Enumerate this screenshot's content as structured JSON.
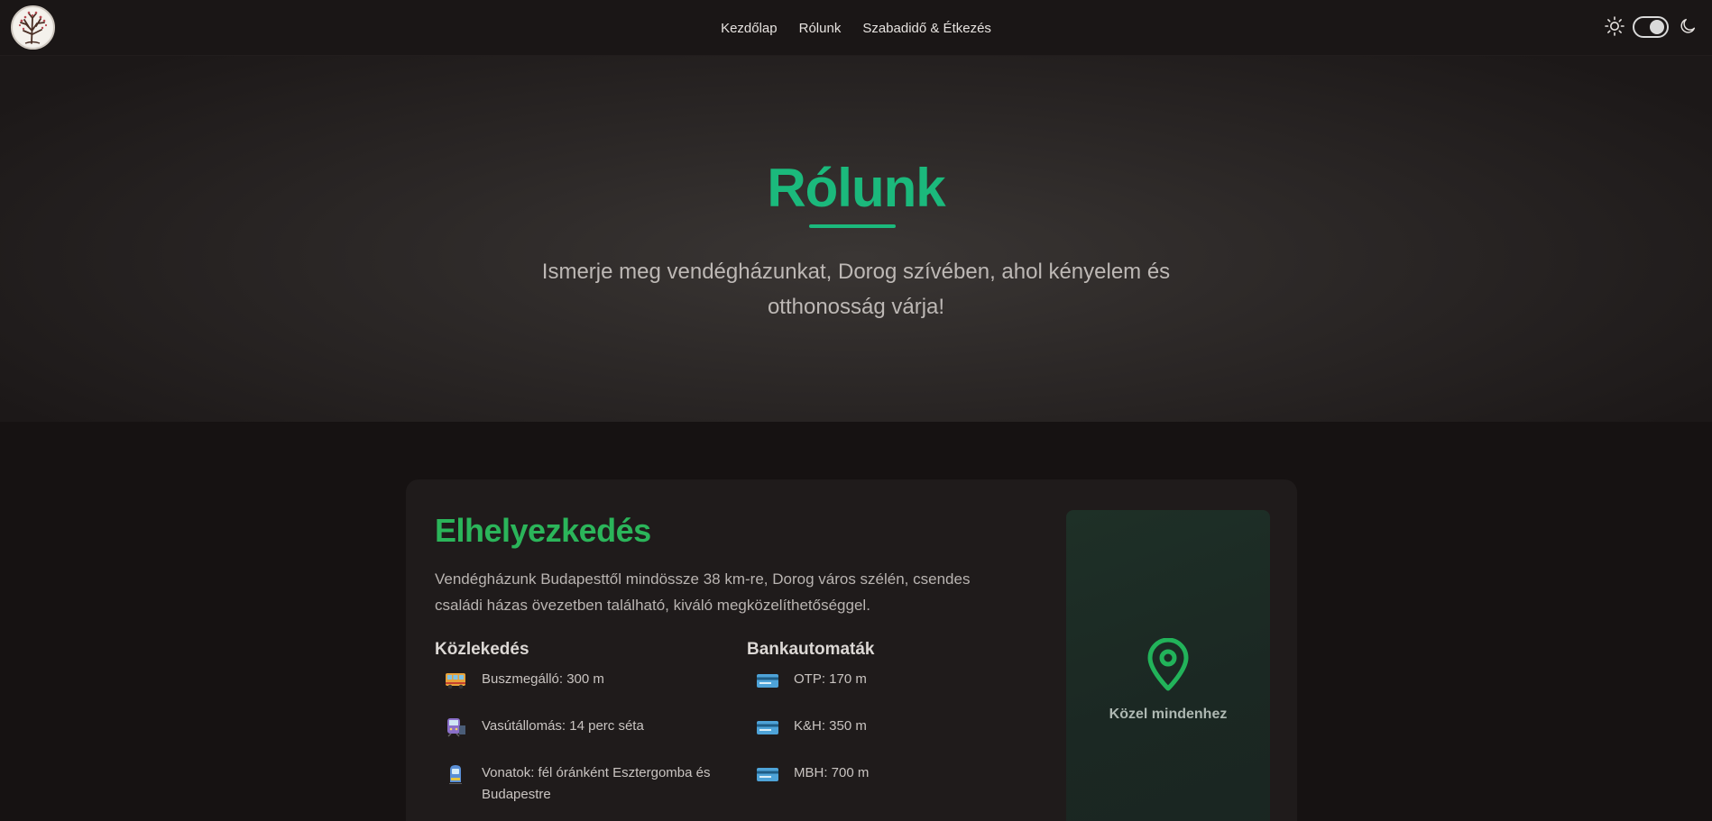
{
  "nav": {
    "links": [
      "Kezdőlap",
      "Rólunk",
      "Szabadidő & Étkezés"
    ]
  },
  "theme": {
    "mode": "dark"
  },
  "hero": {
    "title": "Rólunk",
    "subtitle": "Ismerje meg vendégházunkat, Dorog szívében, ahol kényelem és otthonosság várja!"
  },
  "location": {
    "title": "Elhelyezkedés",
    "intro": "Vendégházunk Budapesttől mindössze 38 km-re, Dorog város szélén, csendes családi házas övezetben található, kiváló megközelíthetőséggel.",
    "transport": {
      "heading": "Közlekedés",
      "items": [
        {
          "icon": "bus-icon",
          "text": "Buszmegálló: 300 m"
        },
        {
          "icon": "train-station-icon",
          "text": "Vasútállomás: 14 perc séta"
        },
        {
          "icon": "train-icon",
          "text": "Vonatok: fél óránként Esztergomba és Budapestre"
        }
      ]
    },
    "atms": {
      "heading": "Bankautomaták",
      "items": [
        {
          "icon": "credit-card-icon",
          "text": "OTP: 170 m"
        },
        {
          "icon": "credit-card-icon",
          "text": "K&H: 350 m"
        },
        {
          "icon": "credit-card-icon",
          "text": "MBH: 700 m"
        }
      ]
    },
    "map": {
      "label": "Közel mindenhez"
    }
  },
  "colors": {
    "accent": "#1bb97c",
    "heading_green": "#2bb55a",
    "background": "#161212"
  }
}
